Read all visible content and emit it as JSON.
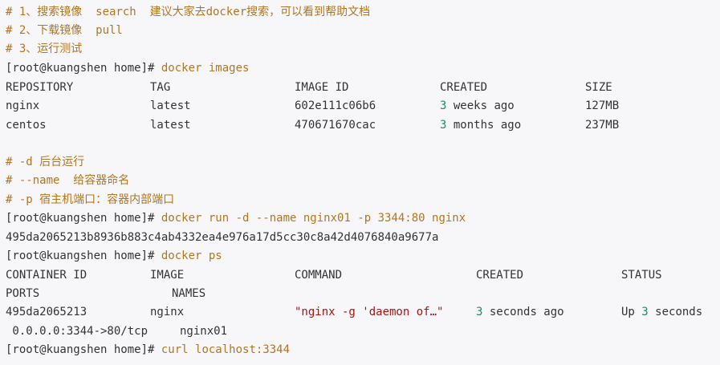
{
  "colors": {
    "background": "#f7f7f9",
    "text": "#333333",
    "comment": "#b3761f",
    "number": "#1a8d5f",
    "string": "#a31515"
  },
  "comments": {
    "c1": "# 1、搜索镜像  search  建议大家去docker搜索，可以看到帮助文档",
    "c2": "# 2、下载镜像  pull",
    "c3": "# 3、运行测试",
    "c4": "# -d 后台运行",
    "c5": "# --name  给容器命名",
    "c6": "# -p 宿主机端口：容器内部端口"
  },
  "prompts": {
    "p1": {
      "prompt": "[root@kuangshen home]#",
      "command": " docker images"
    },
    "p2": {
      "prompt": "[root@kuangshen home]#",
      "command": " docker run -d --name nginx01 -p 3344:80 nginx"
    },
    "p3": {
      "prompt": "[root@kuangshen home]#",
      "command": " docker ps"
    },
    "p4": {
      "prompt": "[root@kuangshen home]#",
      "command": " curl localhost:3344"
    }
  },
  "images_table": {
    "headers": [
      "REPOSITORY",
      "TAG",
      "IMAGE ID",
      "CREATED",
      "SIZE"
    ],
    "rows": [
      {
        "repo": "nginx",
        "tag": "latest",
        "id": "602e111c06b6",
        "created_num": "3",
        "created_rest": " weeks ago",
        "size": "127MB"
      },
      {
        "repo": "centos",
        "tag": "latest",
        "id": "470671670cac",
        "created_num": "3",
        "created_rest": " months ago",
        "size": "237MB"
      }
    ]
  },
  "run_output": "495da2065213b8936b883c4ab4332ea4e976a17d5cc30c8a42d4076840a9677a",
  "ps_table": {
    "headers": [
      "CONTAINER ID",
      "IMAGE",
      "COMMAND",
      "CREATED",
      "STATUS"
    ],
    "headers2": [
      "PORTS",
      "NAMES"
    ],
    "row": {
      "id": "495da2065213",
      "image": "nginx",
      "command": "\"nginx -g 'daemon of…\"",
      "created_num": "3",
      "created_rest": " seconds ago",
      "status_pre": "Up ",
      "status_num": "3",
      "status_rest": " seconds",
      "ports": " 0.0.0.0:3344->80/tcp",
      "names": "nginx01"
    }
  }
}
